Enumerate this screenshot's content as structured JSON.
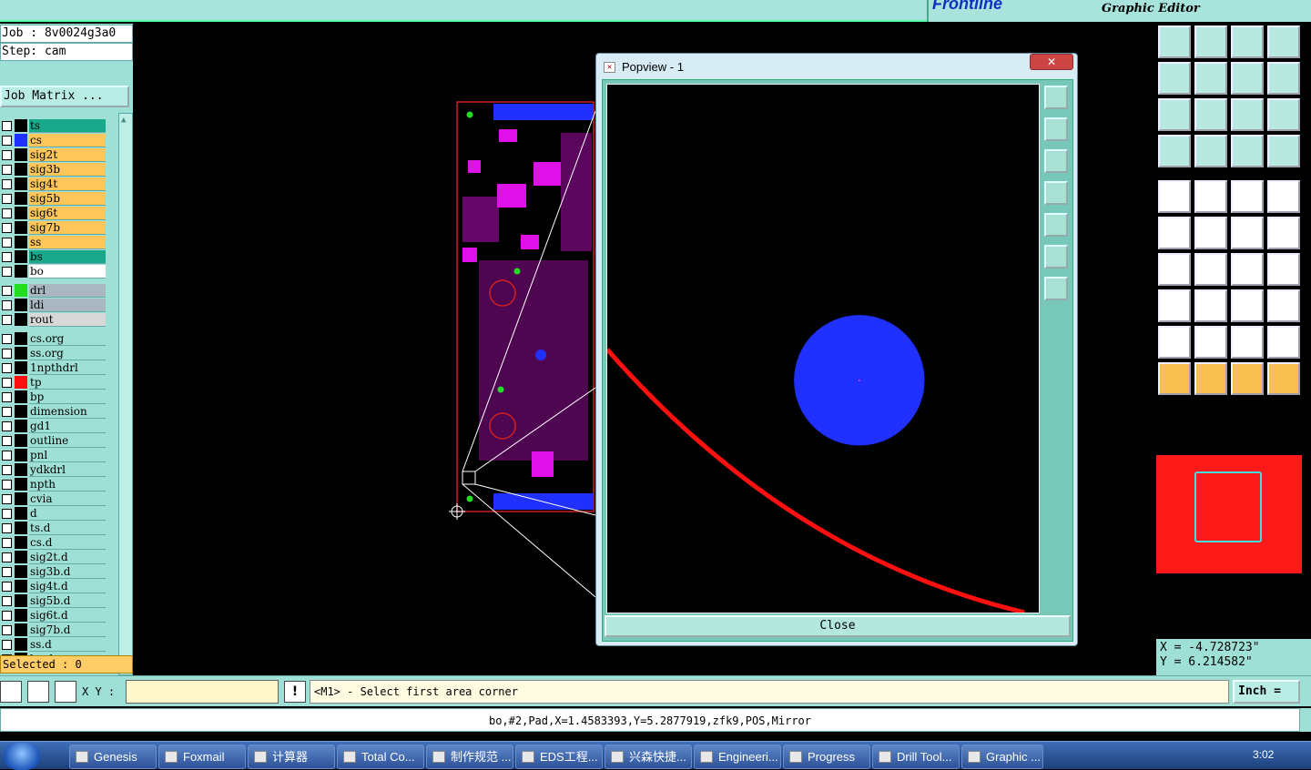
{
  "app": {
    "brand_logo": "Frontline",
    "brand_subtitle": "Graphic Editor"
  },
  "job": {
    "job_line": "Job : 8v0024g3a0",
    "step_line": "Step: cam",
    "matrix_button": "Job Matrix ..."
  },
  "layers": [
    {
      "name": "ts",
      "bg": "#19a88a",
      "swatch": ""
    },
    {
      "name": "cs",
      "bg": "#ffc75a",
      "swatch": "#2030ff"
    },
    {
      "name": "sig2t",
      "bg": "#ffc75a",
      "swatch": ""
    },
    {
      "name": "sig3b",
      "bg": "#ffc75a",
      "swatch": ""
    },
    {
      "name": "sig4t",
      "bg": "#ffc75a",
      "swatch": ""
    },
    {
      "name": "sig5b",
      "bg": "#ffc75a",
      "swatch": ""
    },
    {
      "name": "sig6t",
      "bg": "#ffc75a",
      "swatch": ""
    },
    {
      "name": "sig7b",
      "bg": "#ffc75a",
      "swatch": ""
    },
    {
      "name": "ss",
      "bg": "#ffc75a",
      "swatch": ""
    },
    {
      "name": "bs",
      "bg": "#19a88a",
      "swatch": ""
    },
    {
      "name": "bo",
      "bg": "#ffffff",
      "swatch": ""
    },
    {
      "name": "drl",
      "bg": "#a9b8c0",
      "swatch": "#22dd22"
    },
    {
      "name": "ldi",
      "bg": "#a9b8c0",
      "swatch": ""
    },
    {
      "name": "rout",
      "bg": "#d8d8d8",
      "swatch": ""
    },
    {
      "name": "cs.org",
      "bg": "#9fe0d6",
      "swatch": ""
    },
    {
      "name": "ss.org",
      "bg": "#9fe0d6",
      "swatch": ""
    },
    {
      "name": "1npthdrl",
      "bg": "#9fe0d6",
      "swatch": ""
    },
    {
      "name": "tp",
      "bg": "#9fe0d6",
      "swatch": "#ff1010"
    },
    {
      "name": "bp",
      "bg": "#9fe0d6",
      "swatch": ""
    },
    {
      "name": "dimension",
      "bg": "#9fe0d6",
      "swatch": ""
    },
    {
      "name": "gd1",
      "bg": "#9fe0d6",
      "swatch": ""
    },
    {
      "name": "outline",
      "bg": "#9fe0d6",
      "swatch": ""
    },
    {
      "name": "pnl",
      "bg": "#9fe0d6",
      "swatch": ""
    },
    {
      "name": "ydkdrl",
      "bg": "#9fe0d6",
      "swatch": ""
    },
    {
      "name": "npth",
      "bg": "#9fe0d6",
      "swatch": ""
    },
    {
      "name": "cvia",
      "bg": "#9fe0d6",
      "swatch": ""
    },
    {
      "name": "d",
      "bg": "#9fe0d6",
      "swatch": ""
    },
    {
      "name": "ts.d",
      "bg": "#9fe0d6",
      "swatch": ""
    },
    {
      "name": "cs.d",
      "bg": "#9fe0d6",
      "swatch": ""
    },
    {
      "name": "sig2t.d",
      "bg": "#9fe0d6",
      "swatch": ""
    },
    {
      "name": "sig3b.d",
      "bg": "#9fe0d6",
      "swatch": ""
    },
    {
      "name": "sig4t.d",
      "bg": "#9fe0d6",
      "swatch": ""
    },
    {
      "name": "sig5b.d",
      "bg": "#9fe0d6",
      "swatch": ""
    },
    {
      "name": "sig6t.d",
      "bg": "#9fe0d6",
      "swatch": ""
    },
    {
      "name": "sig7b.d",
      "bg": "#9fe0d6",
      "swatch": ""
    },
    {
      "name": "ss.d",
      "bg": "#9fe0d6",
      "swatch": ""
    },
    {
      "name": "bs.d",
      "bg": "#9fe0d6",
      "swatch": ""
    }
  ],
  "selected": "Selected : 0",
  "popview": {
    "title": "Popview - 1",
    "close_button": "Close",
    "close_x": "✕"
  },
  "coords": {
    "x": "X = -4.728723\"",
    "y": "Y = 6.214582\""
  },
  "command": {
    "xy_label": "X Y :",
    "xy_value": "",
    "bang": "!",
    "prompt": "<M1> - Select first area corner",
    "unit": "Inch ="
  },
  "status": "bo,#2,Pad,X=1.4583393,Y=5.2877919,zfk9,POS,Mirror",
  "taskbar": {
    "items": [
      "Genesis",
      "Foxmail",
      "计算器",
      "Total Co...",
      "制作规范 ...",
      "EDS工程...",
      "兴森快捷...",
      "Engineeri...",
      "Progress",
      "Drill Tool...",
      "Graphic ..."
    ],
    "clock": "3:02"
  },
  "colors": {
    "panel": "#9fe0d6",
    "pad_blue": "#2030ff",
    "trace_red": "#ff1010",
    "board_magenta": "#e010e8"
  }
}
